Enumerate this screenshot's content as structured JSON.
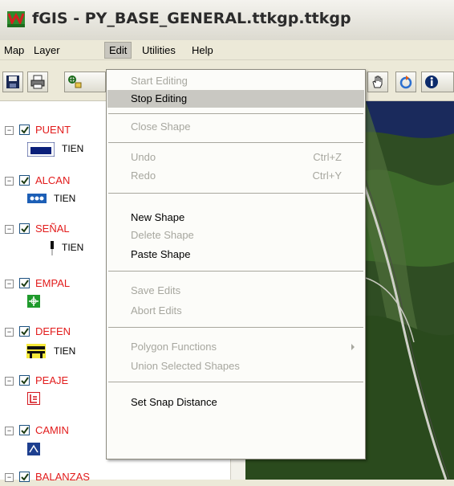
{
  "window": {
    "title": "fGIS - PY_BASE_GENERAL.ttkgp.ttkgp"
  },
  "menubar": {
    "items": [
      "Map",
      "Layer",
      "Edit",
      "Utilities",
      "Help"
    ],
    "active": "Edit"
  },
  "toolbar": {
    "left_buttons": [
      "save-icon",
      "print-icon",
      "add-layer-icon"
    ],
    "right_buttons": [
      "pan-hand-icon",
      "refresh-icon",
      "info-icon"
    ]
  },
  "legend": {
    "layers": [
      {
        "name": "PUENT",
        "symbol_label": "TIEN",
        "checked": true
      },
      {
        "name": "ALCAN",
        "symbol_label": "TIEN",
        "checked": true
      },
      {
        "name": "SEÑAL",
        "symbol_label": "TIEN",
        "checked": true
      },
      {
        "name": "EMPAL",
        "symbol_label": "",
        "checked": true
      },
      {
        "name": "DEFEN",
        "symbol_label": "TIEN",
        "checked": true
      },
      {
        "name": "PEAJE",
        "symbol_label": "",
        "checked": true
      },
      {
        "name": "CAMIN",
        "symbol_label": "",
        "checked": true
      },
      {
        "name": "BALANZAS",
        "symbol_label": "",
        "checked": true
      }
    ]
  },
  "edit_menu": {
    "items": [
      {
        "label": "Start Editing",
        "shortcut": "",
        "enabled": false
      },
      {
        "label": "Stop Editing",
        "shortcut": "",
        "enabled": true,
        "highlighted": true
      },
      {
        "label": "Close Shape",
        "shortcut": "",
        "enabled": false
      },
      {
        "label": "Undo",
        "shortcut": "Ctrl+Z",
        "enabled": false
      },
      {
        "label": "Redo",
        "shortcut": "Ctrl+Y",
        "enabled": false
      },
      {
        "label": "New Shape",
        "shortcut": "",
        "enabled": true
      },
      {
        "label": "Delete Shape",
        "shortcut": "",
        "enabled": false
      },
      {
        "label": "Paste Shape",
        "shortcut": "",
        "enabled": true
      },
      {
        "label": "Save Edits",
        "shortcut": "",
        "enabled": false
      },
      {
        "label": "Abort Edits",
        "shortcut": "",
        "enabled": false
      },
      {
        "label": "Polygon Functions",
        "shortcut": "",
        "enabled": false,
        "submenu": true
      },
      {
        "label": "Union Selected Shapes",
        "shortcut": "",
        "enabled": false
      },
      {
        "label": "Set Snap Distance",
        "shortcut": "",
        "enabled": true
      }
    ]
  },
  "colors": {
    "layer_name": "#e21b1b",
    "menu_highlight": "#c9c8c2",
    "disabled_text": "#a7a79f"
  }
}
